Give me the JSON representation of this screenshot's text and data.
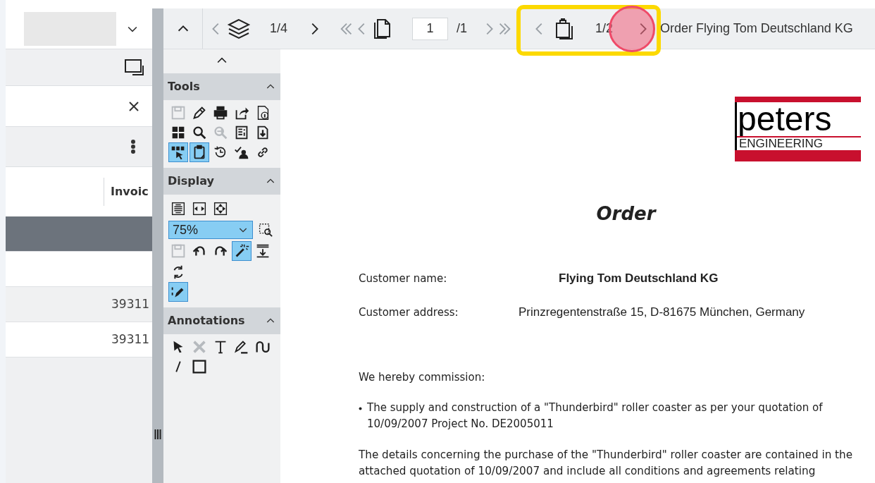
{
  "left_panel": {
    "dropdown": {
      "redacted": true
    },
    "column_header": "Invoic",
    "rows": [
      {
        "selected": true
      },
      {
        "selected": false
      },
      {
        "selected": false,
        "invoice": "39311"
      },
      {
        "selected": false,
        "invoice": "39311"
      }
    ]
  },
  "toolbar": {
    "layer_nav": {
      "prev": {
        "disabled": true
      },
      "counter": "1/4",
      "next": {
        "disabled": false
      }
    },
    "page_nav": {
      "first": {
        "disabled": true
      },
      "prev": {
        "disabled": true
      },
      "page": "1",
      "total": "/1",
      "next": {
        "disabled": true
      },
      "last": {
        "disabled": true
      }
    },
    "attachment_nav": {
      "prev": {
        "disabled": true
      },
      "counter": "1/2",
      "next": {
        "disabled": false
      }
    },
    "document_title": "Order Flying Tom Deutschland KG"
  },
  "tutorial_overlay": {
    "highlight": true,
    "click_marker": true
  },
  "side_panel": {
    "sections": [
      {
        "title": "Tools",
        "expanded": true,
        "rows": [
          [
            {
              "kind": "icon",
              "selected": false,
              "disabled": true
            },
            {
              "kind": "icon",
              "selected": false,
              "disabled": false
            },
            {
              "kind": "icon",
              "selected": false,
              "disabled": false
            },
            {
              "kind": "icon",
              "selected": false,
              "disabled": false
            },
            {
              "kind": "icon",
              "selected": false,
              "disabled": false
            }
          ],
          [
            {
              "kind": "icon",
              "selected": false,
              "disabled": false
            },
            {
              "kind": "icon",
              "selected": false,
              "disabled": false
            },
            {
              "kind": "icon",
              "selected": false,
              "disabled": true
            },
            {
              "kind": "icon",
              "selected": false,
              "disabled": false
            },
            {
              "kind": "icon",
              "selected": false,
              "disabled": false
            }
          ],
          [
            {
              "kind": "icon",
              "selected": true,
              "disabled": false
            },
            {
              "kind": "icon",
              "selected": true,
              "disabled": false
            },
            {
              "kind": "icon",
              "selected": false,
              "disabled": false
            },
            {
              "kind": "icon",
              "selected": false,
              "disabled": false
            },
            {
              "kind": "icon",
              "selected": false,
              "disabled": false
            }
          ]
        ]
      },
      {
        "title": "Display",
        "expanded": true,
        "rows": [
          [
            {
              "kind": "icon",
              "selected": false,
              "disabled": false
            },
            {
              "kind": "icon",
              "selected": false,
              "disabled": false
            },
            {
              "kind": "icon",
              "selected": false,
              "disabled": false
            }
          ],
          [
            {
              "kind": "select",
              "value": "75%"
            },
            {
              "kind": "icon",
              "selected": false,
              "disabled": false
            }
          ],
          [
            {
              "kind": "icon",
              "selected": false,
              "disabled": true
            },
            {
              "kind": "icon",
              "selected": false,
              "disabled": false
            },
            {
              "kind": "icon",
              "selected": false,
              "disabled": false
            },
            {
              "kind": "icon",
              "selected": true,
              "disabled": false
            },
            {
              "kind": "icon",
              "selected": false,
              "disabled": false
            }
          ],
          [
            {
              "kind": "icon",
              "selected": false,
              "disabled": false
            }
          ],
          [
            {
              "kind": "icon",
              "selected": true,
              "disabled": false
            }
          ]
        ]
      },
      {
        "title": "Annotations",
        "expanded": true,
        "rows": [
          [
            {
              "kind": "icon",
              "selected": false,
              "disabled": false
            },
            {
              "kind": "icon",
              "selected": false,
              "disabled": true
            },
            {
              "kind": "icon",
              "selected": false,
              "disabled": false
            },
            {
              "kind": "icon",
              "selected": false,
              "disabled": false
            },
            {
              "kind": "icon",
              "selected": false,
              "disabled": false
            }
          ],
          [
            {
              "kind": "icon",
              "selected": false,
              "disabled": false
            },
            {
              "kind": "icon",
              "selected": false,
              "disabled": false
            }
          ]
        ]
      }
    ]
  },
  "document": {
    "logo": {
      "name": "peters",
      "tagline": "ENGINEERING"
    },
    "title": "Order",
    "fields": [
      {
        "label": "Customer name:",
        "value": "Flying Tom Deutschland KG",
        "bold": true
      },
      {
        "label": "Customer address:",
        "value": "Prinzregentenstraße 15, D-81675 München, Germany",
        "bold": false
      }
    ],
    "intro": "We hereby commission:",
    "bullets": [
      "The supply and construction of a \"Thunderbird\" roller coaster as per your quotation of 10/09/2007 Project No. DE2005011"
    ],
    "paragraph": "The details concerning the purchase of the \"Thunderbird\" roller coaster are contained in the attached quotation of 10/09/2007 and include all conditions and agreements relating"
  }
}
